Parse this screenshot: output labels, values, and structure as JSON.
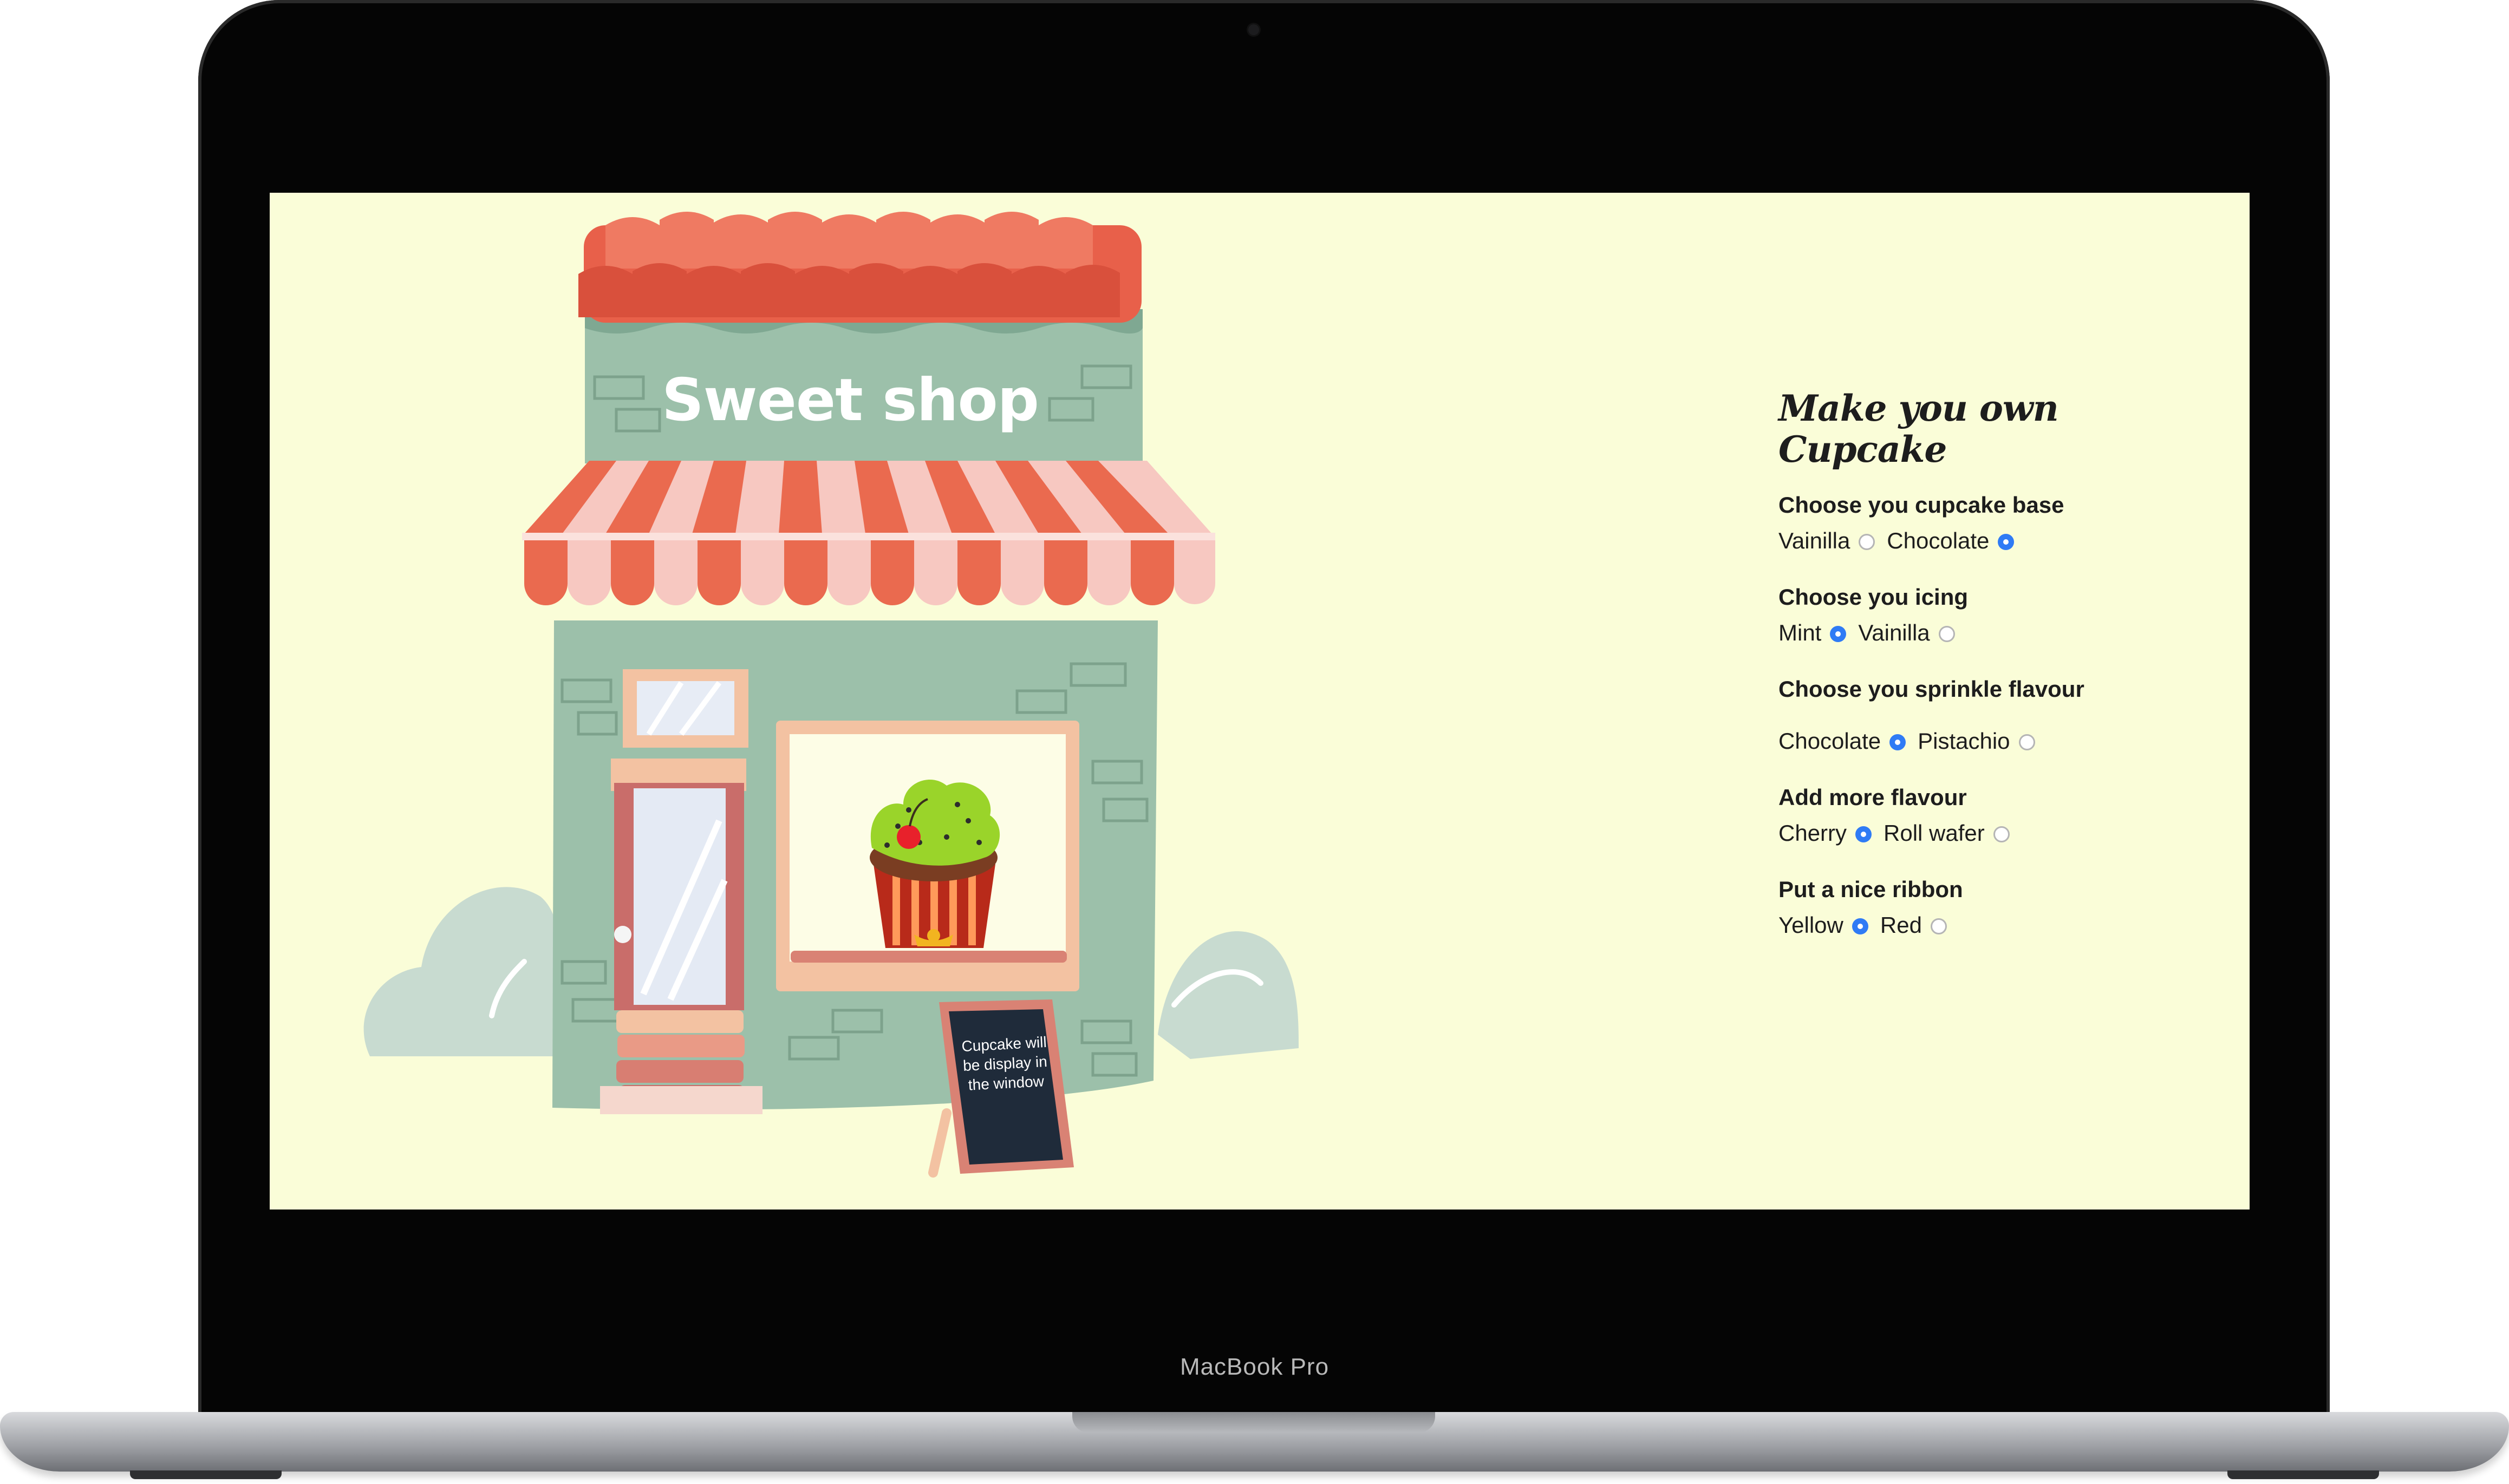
{
  "device": {
    "label": "MacBook Pro"
  },
  "shop": {
    "sign": "Sweet shop",
    "board": "Cupcake will be display in the window"
  },
  "form": {
    "title_line1": "Make you own",
    "title_line2": "Cupcake",
    "groups": [
      {
        "label": "Choose you cupcake base",
        "options": [
          {
            "label": "Vainilla",
            "checked": false
          },
          {
            "label": "Chocolate",
            "checked": true
          }
        ]
      },
      {
        "label": "Choose you icing",
        "options": [
          {
            "label": "Mint",
            "checked": true
          },
          {
            "label": "Vainilla",
            "checked": false
          }
        ]
      },
      {
        "label": "Choose you sprinkle flavour",
        "options": [
          {
            "label": "Chocolate",
            "checked": true
          },
          {
            "label": "Pistachio",
            "checked": false
          }
        ]
      },
      {
        "label": "Add more flavour",
        "options": [
          {
            "label": "Cherry",
            "checked": true
          },
          {
            "label": "Roll wafer",
            "checked": false
          }
        ]
      },
      {
        "label": "Put a nice ribbon",
        "options": [
          {
            "label": "Yellow",
            "checked": true
          },
          {
            "label": "Red",
            "checked": false
          }
        ]
      }
    ]
  },
  "colors": {
    "page_bg": "#fafdd8",
    "radio_selected": "#2f7bf5",
    "shop_wall": "#9cc0aa",
    "roof": "#e8604a",
    "awning_red": "#ea6a4f",
    "awning_pink": "#f7c8c1",
    "icing": "#9ad42a",
    "cupcake_base": "#7a3d22"
  }
}
